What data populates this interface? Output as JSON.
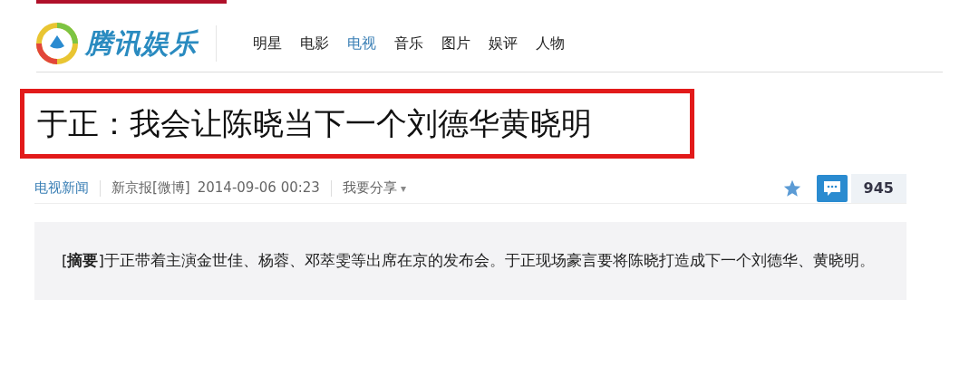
{
  "header": {
    "logo_text": "腾讯娱乐",
    "nav": [
      {
        "label": "明星",
        "selected": false
      },
      {
        "label": "电影",
        "selected": false
      },
      {
        "label": "电视",
        "selected": true
      },
      {
        "label": "音乐",
        "selected": false
      },
      {
        "label": "图片",
        "selected": false
      },
      {
        "label": "娱评",
        "selected": false
      },
      {
        "label": "人物",
        "selected": false
      }
    ]
  },
  "article": {
    "title": "于正：我会让陈晓当下一个刘德华黄晓明",
    "title_highlighted": true,
    "meta": {
      "category": "电视新闻",
      "source": "新京报[微博]",
      "datetime": "2014-09-06 00:23",
      "share": "我要分享",
      "share_caret": "▾",
      "comment_count": "945"
    },
    "summary": "[**摘要**]于正带着主演金世佳、杨蓉、邓萃雯等出席在京的发布会。于正现场豪言要将陈晓打造成下一个刘德华、黄晓明。"
  }
}
